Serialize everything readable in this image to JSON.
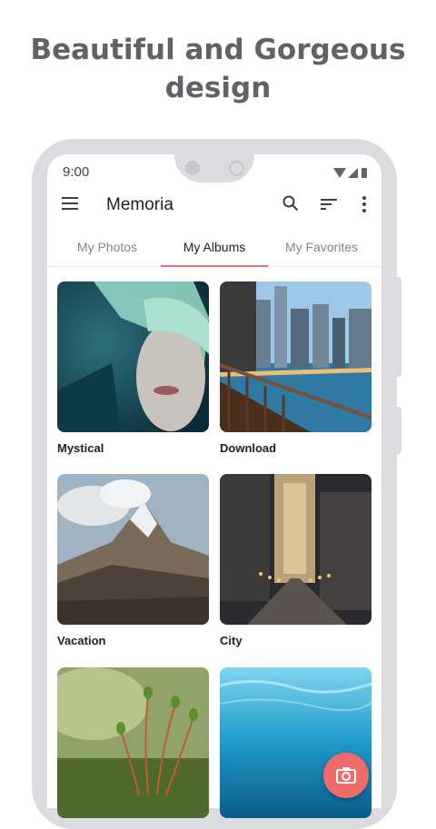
{
  "headline": {
    "line1": "Beautiful and Gorgeous",
    "line2": "design"
  },
  "status_bar": {
    "time": "9:00"
  },
  "app_bar": {
    "title": "Memoria"
  },
  "tabs": [
    {
      "label": "My Photos",
      "selected": false
    },
    {
      "label": "My Albums",
      "selected": true
    },
    {
      "label": "My Favorites",
      "selected": false
    }
  ],
  "albums": [
    {
      "name": "Mystical"
    },
    {
      "name": "Download"
    },
    {
      "name": "Vacation"
    },
    {
      "name": "City"
    },
    {
      "name": ""
    },
    {
      "name": ""
    }
  ],
  "colors": {
    "accent": "#ef6b6b",
    "tab_indicator": "#e57373",
    "frame": "#dadce0"
  },
  "icons": {
    "menu": "menu-icon",
    "search": "search-icon",
    "sort": "sort-icon",
    "more": "more-vert-icon",
    "fab": "camera-icon"
  }
}
